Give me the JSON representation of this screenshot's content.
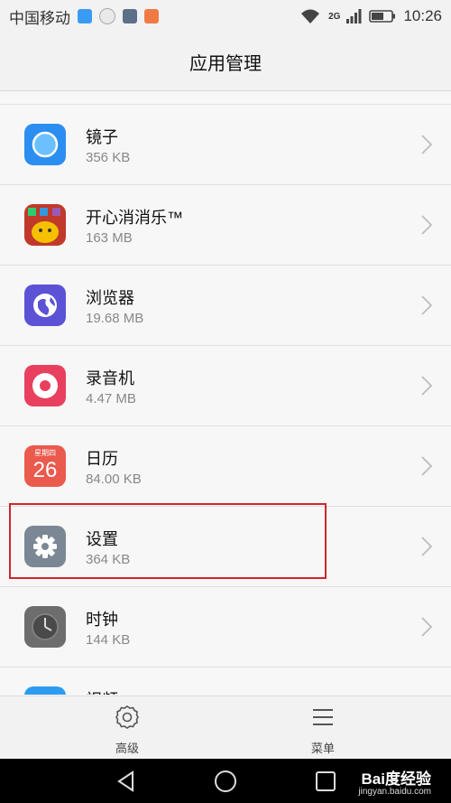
{
  "status": {
    "carrier": "中国移动",
    "network": "2G",
    "time": "10:26"
  },
  "header": {
    "title": "应用管理"
  },
  "apps": [
    {
      "name": "镜子",
      "size": "356 KB",
      "icon": "mirror-icon"
    },
    {
      "name": "开心消消乐™",
      "size": "163 MB",
      "icon": "happy-elimination-icon"
    },
    {
      "name": "浏览器",
      "size": "19.68 MB",
      "icon": "browser-icon"
    },
    {
      "name": "录音机",
      "size": "4.47 MB",
      "icon": "recorder-icon"
    },
    {
      "name": "日历",
      "size": "84.00 KB",
      "icon": "calendar-icon",
      "calendar_weekday": "星期四",
      "calendar_day": "26"
    },
    {
      "name": "设置",
      "size": "364 KB",
      "icon": "settings-icon"
    },
    {
      "name": "时钟",
      "size": "144 KB",
      "icon": "clock-icon"
    },
    {
      "name": "视频",
      "size": "",
      "icon": "video-icon"
    }
  ],
  "bottom": {
    "advanced_label": "高级",
    "menu_label": "菜单"
  },
  "watermark": {
    "brand": "Bai度经验",
    "url": "jingyan.baidu.com"
  },
  "colors": {
    "highlight": "#d0262d",
    "mirror": "#2b8ef0",
    "browser": "#5b52d6",
    "recorder": "#e8405e",
    "calendar": "#ea5a4d",
    "settings": "#7b8794",
    "clock": "#6d6d6d",
    "video": "#2b9cf0"
  }
}
